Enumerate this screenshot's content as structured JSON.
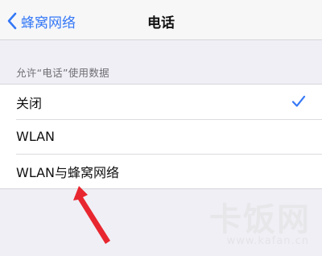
{
  "navbar": {
    "back_label": "蜂窝网络",
    "title": "电话"
  },
  "section": {
    "header": "允许“电话”使用数据"
  },
  "options": [
    {
      "label": "关闭",
      "selected": true
    },
    {
      "label": "WLAN",
      "selected": false
    },
    {
      "label": "WLAN与蜂窝网络",
      "selected": false
    }
  ],
  "icons": {
    "back": "chevron-left-icon",
    "selected": "checkmark-icon"
  },
  "watermark": {
    "text": "卡饭网",
    "sub": "www.kafan.cn"
  },
  "colors": {
    "accent": "#3478f6",
    "annotation_arrow": "#e8262f",
    "background": "#f0eff5"
  }
}
